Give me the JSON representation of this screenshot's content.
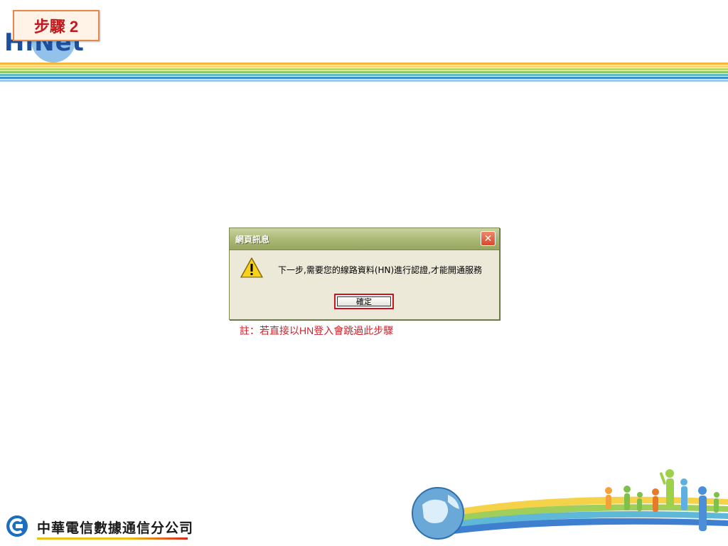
{
  "header": {
    "logo_text": "HiNet",
    "step_label": "步驟 2"
  },
  "colors": {
    "stripes": [
      "#f6b43c",
      "#f9d27a",
      "#b9d86a",
      "#8cc86a",
      "#5fb8c8",
      "#3e8fd0",
      "#9fc8ee"
    ],
    "accent_red": "#d01f2a"
  },
  "dialog": {
    "title": "網頁訊息",
    "message": "下一步,需要您的線路資料(HN)進行認證,才能開通服務",
    "ok_label": "確定",
    "icon": "warning-icon",
    "close_icon": "close-icon"
  },
  "note": {
    "prefix": "註：若直接以",
    "highlight": "HN",
    "suffix": "登入會跳過此步驟"
  },
  "footer": {
    "company_name": "中華電信數據通信分公司"
  }
}
